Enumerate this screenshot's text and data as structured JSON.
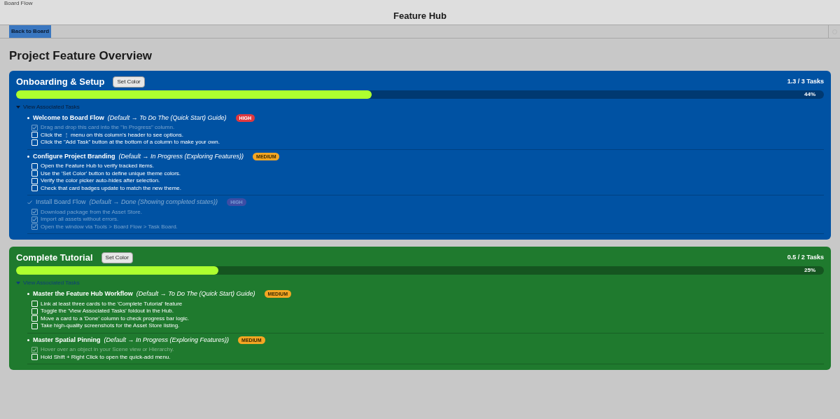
{
  "window": {
    "tab_title": "Board Flow",
    "title": "Feature Hub"
  },
  "toolbar": {
    "back_button": "Back to Board"
  },
  "page_title": "Project Feature Overview",
  "features": [
    {
      "name": "Onboarding & Setup",
      "color": "#0052a3",
      "set_color_button": "Set Color",
      "progress_text": "1.3 / 3 Tasks",
      "level": 0.44,
      "percent": "44%",
      "foldout": {
        "label": "View Associated Tasks",
        "expanded": true
      },
      "tasks": [
        {
          "title": "Welcome to Board Flow",
          "path": "(Default → To Do The (Quick Start) Guide)",
          "kind": "high",
          "badge": "HIGH",
          "done": false,
          "steps": [
            {
              "text": "Drag and drop this card into the \"In Progress\" column.",
              "checked": true
            },
            {
              "text": "Click the ⋮ menu on this column's header to see options.",
              "checked": false
            },
            {
              "text": "Click the \"Add Task\" button at the bottom of a column to make your own.",
              "checked": false
            }
          ]
        },
        {
          "title": "Configure Project Branding",
          "path": "(Default → In Progress (Exploring Features))",
          "kind": "medium",
          "badge": "MEDIUM",
          "done": false,
          "steps": [
            {
              "text": "Open the Feature Hub to verify tracked items.",
              "checked": false
            },
            {
              "text": "Use the 'Set Color' button to define unique theme colors.",
              "checked": false
            },
            {
              "text": "Verify the color picker auto-hides after selection.",
              "checked": false
            },
            {
              "text": "Check that card badges update to match the new theme.",
              "checked": false
            }
          ]
        },
        {
          "title": "Install Board Flow",
          "path": "(Default → Done (Showing completed states))",
          "kind": "high",
          "badge": "HIGH",
          "done": true,
          "steps": [
            {
              "text": "Download package from the Asset Store.",
              "checked": true
            },
            {
              "text": "Import all assets without errors.",
              "checked": true
            },
            {
              "text": "Open the window via Tools > Board Flow > Task Board.",
              "checked": true
            }
          ]
        }
      ]
    },
    {
      "name": "Complete Tutorial",
      "color": "#1f7a2e",
      "set_color_button": "Set Color",
      "progress_text": "0.5 / 2 Tasks",
      "level": 0.25,
      "percent": "25%",
      "foldout": {
        "label": "View Associated Tasks",
        "expanded": true
      },
      "tasks": [
        {
          "title": "Master the Feature Hub Workflow",
          "path": "(Default → To Do The (Quick Start) Guide)",
          "kind": "medium",
          "badge": "MEDIUM",
          "done": false,
          "steps": [
            {
              "text": "Link at least three cards to the 'Complete Tutorial' feature",
              "checked": false
            },
            {
              "text": "Toggle the 'View Associated Tasks' foldout in the Hub.",
              "checked": false
            },
            {
              "text": "Move a card to a 'Done' column to check progress bar logic.",
              "checked": false
            },
            {
              "text": "Take high-quality screenshots for the Asset Store listing.",
              "checked": false
            }
          ]
        },
        {
          "title": "Master Spatial Pinning",
          "path": "(Default → In Progress (Exploring Features))",
          "kind": "medium",
          "badge": "MEDIUM",
          "done": false,
          "steps": [
            {
              "text": "Hover over an object in your Scene view or Hierarchy.",
              "checked": true
            },
            {
              "text": "Hold Shift + Right Click to open the quick-add menu.",
              "checked": false
            }
          ]
        }
      ]
    }
  ]
}
